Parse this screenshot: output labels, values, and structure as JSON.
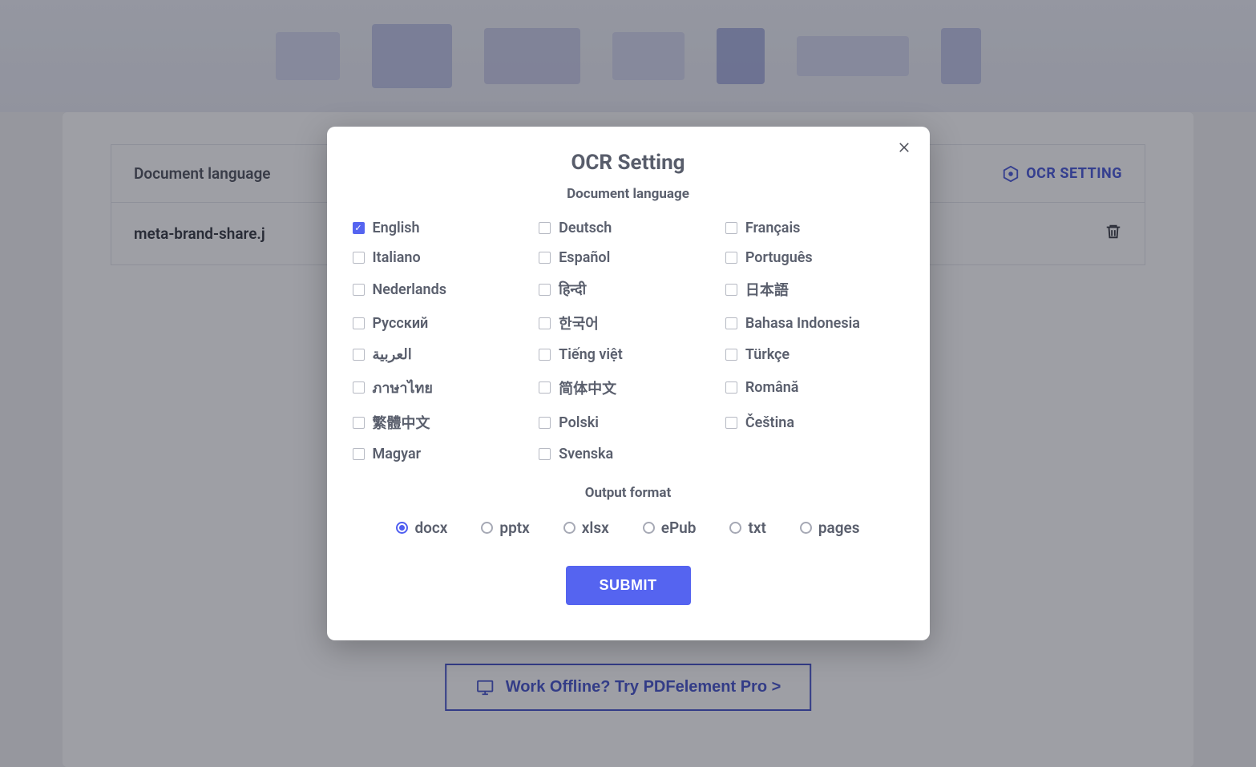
{
  "background": {
    "doc_language_label": "Document language",
    "ocr_setting_label": "OCR SETTING",
    "file_name": "meta-brand-share.j",
    "offline_button": "Work Offline? Try PDFelement Pro >"
  },
  "modal": {
    "title": "OCR Setting",
    "language_section_title": "Document language",
    "languages": [
      {
        "label": "English",
        "checked": true
      },
      {
        "label": "Deutsch",
        "checked": false
      },
      {
        "label": "Français",
        "checked": false
      },
      {
        "label": "Italiano",
        "checked": false
      },
      {
        "label": "Español",
        "checked": false
      },
      {
        "label": "Português",
        "checked": false
      },
      {
        "label": "Nederlands",
        "checked": false
      },
      {
        "label": "हिन्दी",
        "checked": false
      },
      {
        "label": "日本語",
        "checked": false
      },
      {
        "label": "Русский",
        "checked": false
      },
      {
        "label": "한국어",
        "checked": false
      },
      {
        "label": "Bahasa Indonesia",
        "checked": false
      },
      {
        "label": "العربية",
        "checked": false
      },
      {
        "label": "Tiếng việt",
        "checked": false
      },
      {
        "label": "Türkçe",
        "checked": false
      },
      {
        "label": "ภาษาไทย",
        "checked": false
      },
      {
        "label": "简体中文",
        "checked": false
      },
      {
        "label": "Română",
        "checked": false
      },
      {
        "label": "繁體中文",
        "checked": false
      },
      {
        "label": "Polski",
        "checked": false
      },
      {
        "label": "Čeština",
        "checked": false
      },
      {
        "label": "Magyar",
        "checked": false
      },
      {
        "label": "Svenska",
        "checked": false
      }
    ],
    "output_section_title": "Output format",
    "formats": [
      {
        "label": "docx",
        "selected": true
      },
      {
        "label": "pptx",
        "selected": false
      },
      {
        "label": "xlsx",
        "selected": false
      },
      {
        "label": "ePub",
        "selected": false
      },
      {
        "label": "txt",
        "selected": false
      },
      {
        "label": "pages",
        "selected": false
      }
    ],
    "submit_label": "SUBMIT"
  }
}
